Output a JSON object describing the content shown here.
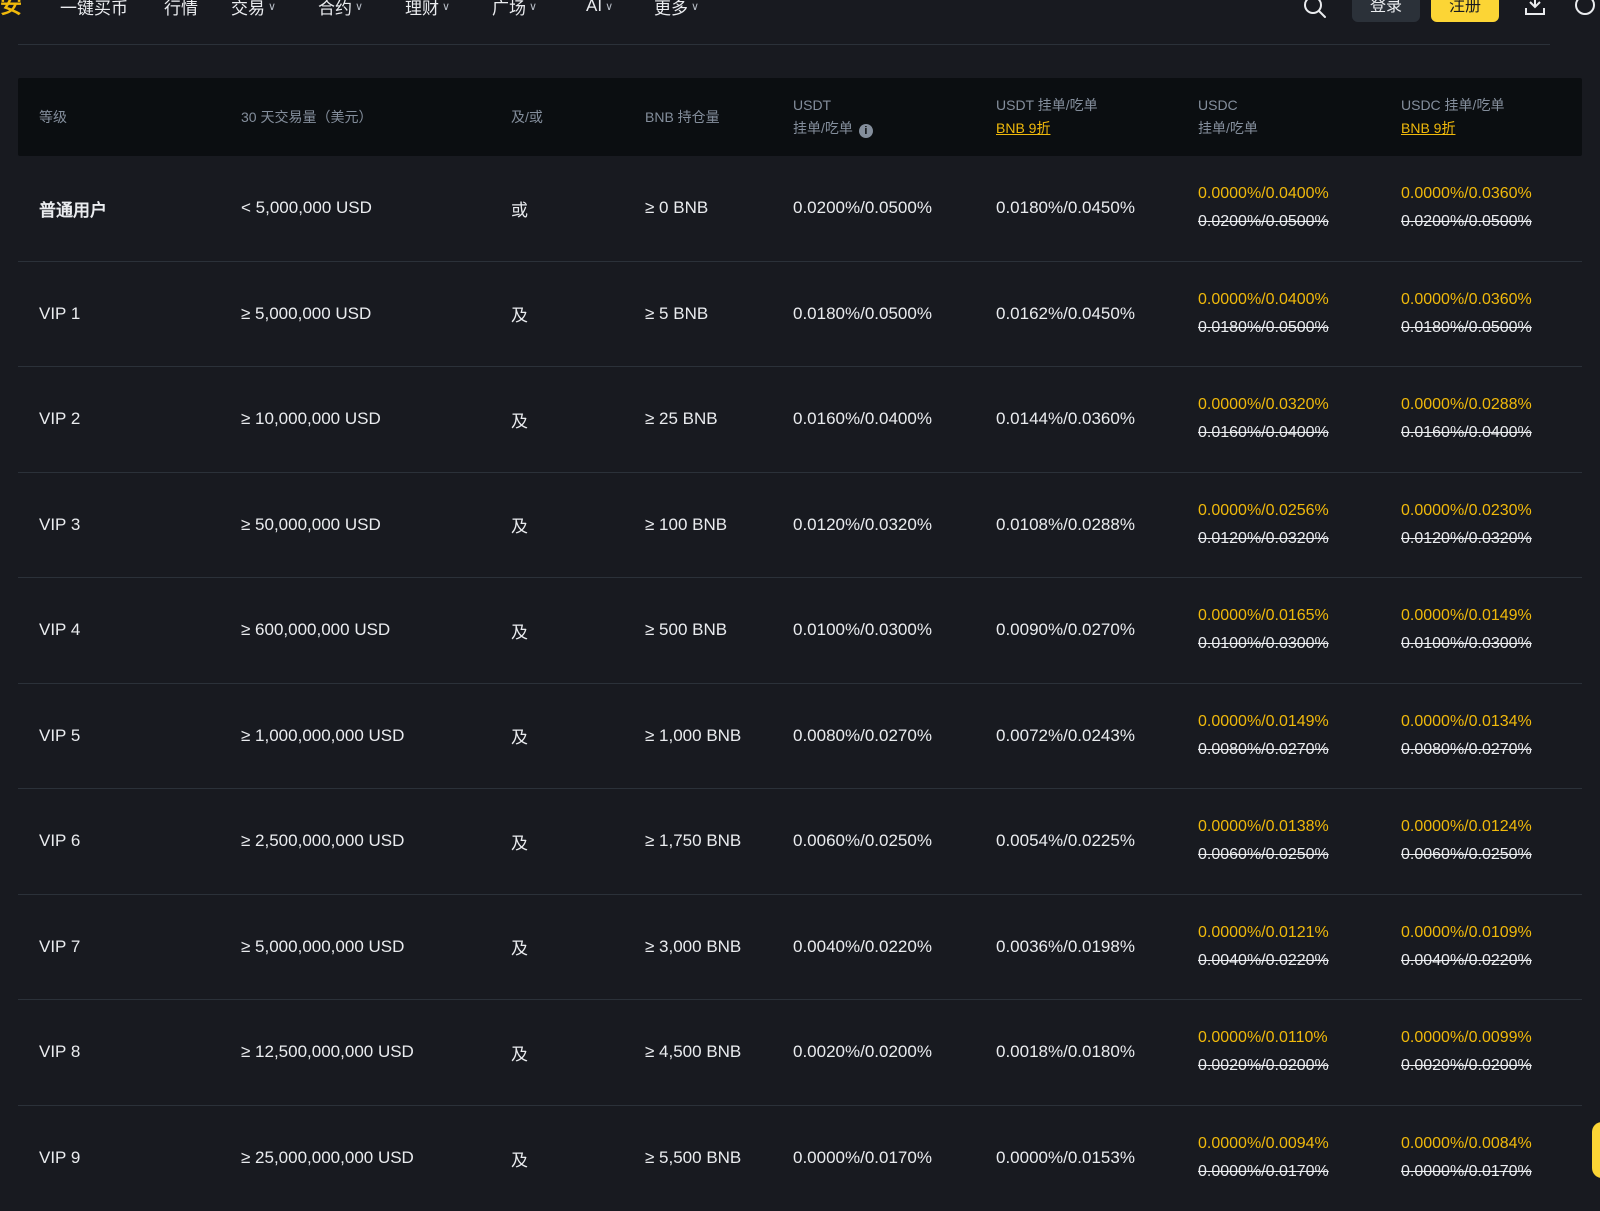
{
  "header": {
    "logo": "安",
    "nav": [
      {
        "label": "一键买币",
        "has_menu": false
      },
      {
        "label": "行情",
        "has_menu": false
      },
      {
        "label": "交易",
        "has_menu": true
      },
      {
        "label": "合约",
        "has_menu": true
      },
      {
        "label": "理财",
        "has_menu": true
      },
      {
        "label": "广场",
        "has_menu": true
      },
      {
        "label": "AI",
        "has_menu": true
      },
      {
        "label": "更多",
        "has_menu": true
      }
    ],
    "login_label": "登录",
    "register_label": "注册",
    "accent_color": "#fcd535"
  },
  "table": {
    "headers": {
      "level": "等级",
      "volume": "30 天交易量（美元）",
      "and_or": "及/或",
      "bnb_holding": "BNB 持仓量",
      "usdt_line1": "USDT",
      "usdt_line2": "挂单/吃单",
      "usdt_bnb_line1": "USDT 挂单/吃单",
      "usdt_bnb_line2": "BNB 9折",
      "usdc_line1": "USDC",
      "usdc_line2": "挂单/吃单",
      "usdc_bnb_line1": "USDC 挂单/吃单",
      "usdc_bnb_line2": "BNB 9折"
    },
    "rows": [
      {
        "level": "普通用户",
        "volume": "< 5,000,000 USD",
        "cond": "或",
        "bnb": "≥ 0 BNB",
        "usdt": "0.0200%/0.0500%",
        "usdt_bnb": "0.0180%/0.0450%",
        "usdc_promo": "0.0000%/0.0400%",
        "usdc_orig": "0.0200%/0.0500%",
        "usdc_bnb_promo": "0.0000%/0.0360%",
        "usdc_bnb_orig": "0.0200%/0.0500%"
      },
      {
        "level": "VIP 1",
        "volume": "≥ 5,000,000 USD",
        "cond": "及",
        "bnb": "≥ 5 BNB",
        "usdt": "0.0180%/0.0500%",
        "usdt_bnb": "0.0162%/0.0450%",
        "usdc_promo": "0.0000%/0.0400%",
        "usdc_orig": "0.0180%/0.0500%",
        "usdc_bnb_promo": "0.0000%/0.0360%",
        "usdc_bnb_orig": "0.0180%/0.0500%"
      },
      {
        "level": "VIP 2",
        "volume": "≥ 10,000,000 USD",
        "cond": "及",
        "bnb": "≥ 25 BNB",
        "usdt": "0.0160%/0.0400%",
        "usdt_bnb": "0.0144%/0.0360%",
        "usdc_promo": "0.0000%/0.0320%",
        "usdc_orig": "0.0160%/0.0400%",
        "usdc_bnb_promo": "0.0000%/0.0288%",
        "usdc_bnb_orig": "0.0160%/0.0400%"
      },
      {
        "level": "VIP 3",
        "volume": "≥ 50,000,000 USD",
        "cond": "及",
        "bnb": "≥ 100 BNB",
        "usdt": "0.0120%/0.0320%",
        "usdt_bnb": "0.0108%/0.0288%",
        "usdc_promo": "0.0000%/0.0256%",
        "usdc_orig": "0.0120%/0.0320%",
        "usdc_bnb_promo": "0.0000%/0.0230%",
        "usdc_bnb_orig": "0.0120%/0.0320%"
      },
      {
        "level": "VIP 4",
        "volume": "≥ 600,000,000 USD",
        "cond": "及",
        "bnb": "≥ 500 BNB",
        "usdt": "0.0100%/0.0300%",
        "usdt_bnb": "0.0090%/0.0270%",
        "usdc_promo": "0.0000%/0.0165%",
        "usdc_orig": "0.0100%/0.0300%",
        "usdc_bnb_promo": "0.0000%/0.0149%",
        "usdc_bnb_orig": "0.0100%/0.0300%"
      },
      {
        "level": "VIP 5",
        "volume": "≥ 1,000,000,000 USD",
        "cond": "及",
        "bnb": "≥ 1,000 BNB",
        "usdt": "0.0080%/0.0270%",
        "usdt_bnb": "0.0072%/0.0243%",
        "usdc_promo": "0.0000%/0.0149%",
        "usdc_orig": "0.0080%/0.0270%",
        "usdc_bnb_promo": "0.0000%/0.0134%",
        "usdc_bnb_orig": "0.0080%/0.0270%"
      },
      {
        "level": "VIP 6",
        "volume": "≥ 2,500,000,000 USD",
        "cond": "及",
        "bnb": "≥ 1,750 BNB",
        "usdt": "0.0060%/0.0250%",
        "usdt_bnb": "0.0054%/0.0225%",
        "usdc_promo": "0.0000%/0.0138%",
        "usdc_orig": "0.0060%/0.0250%",
        "usdc_bnb_promo": "0.0000%/0.0124%",
        "usdc_bnb_orig": "0.0060%/0.0250%"
      },
      {
        "level": "VIP 7",
        "volume": "≥ 5,000,000,000 USD",
        "cond": "及",
        "bnb": "≥ 3,000 BNB",
        "usdt": "0.0040%/0.0220%",
        "usdt_bnb": "0.0036%/0.0198%",
        "usdc_promo": "0.0000%/0.0121%",
        "usdc_orig": "0.0040%/0.0220%",
        "usdc_bnb_promo": "0.0000%/0.0109%",
        "usdc_bnb_orig": "0.0040%/0.0220%"
      },
      {
        "level": "VIP 8",
        "volume": "≥ 12,500,000,000 USD",
        "cond": "及",
        "bnb": "≥ 4,500 BNB",
        "usdt": "0.0020%/0.0200%",
        "usdt_bnb": "0.0018%/0.0180%",
        "usdc_promo": "0.0000%/0.0110%",
        "usdc_orig": "0.0020%/0.0200%",
        "usdc_bnb_promo": "0.0000%/0.0099%",
        "usdc_bnb_orig": "0.0020%/0.0200%"
      },
      {
        "level": "VIP 9",
        "volume": "≥ 25,000,000,000 USD",
        "cond": "及",
        "bnb": "≥ 5,500 BNB",
        "usdt": "0.0000%/0.0170%",
        "usdt_bnb": "0.0000%/0.0153%",
        "usdc_promo": "0.0000%/0.0094%",
        "usdc_orig": "0.0000%/0.0170%",
        "usdc_bnb_promo": "0.0000%/0.0084%",
        "usdc_bnb_orig": "0.0000%/0.0170%"
      }
    ]
  }
}
